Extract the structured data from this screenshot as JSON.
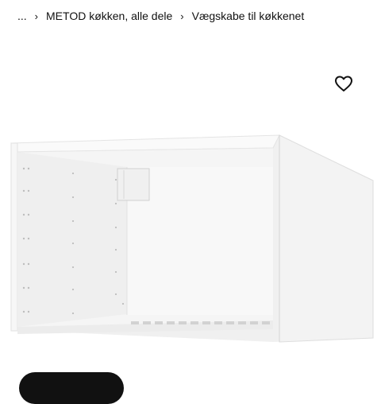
{
  "breadcrumb": {
    "items": [
      {
        "label": "..."
      },
      {
        "label": "METOD køkken, alle dele"
      },
      {
        "label": "Vægskabe til køkkenet"
      }
    ],
    "separator_icon": "chevron-right-icon"
  },
  "favorite": {
    "icon": "heart-outline-icon"
  },
  "product_image": {
    "subject": "wall-cabinet-frame"
  },
  "colors": {
    "text": "#111111",
    "cabinet": "#f4f4f4",
    "cabinet_shadow": "#dcdcdc",
    "button": "#111111"
  }
}
